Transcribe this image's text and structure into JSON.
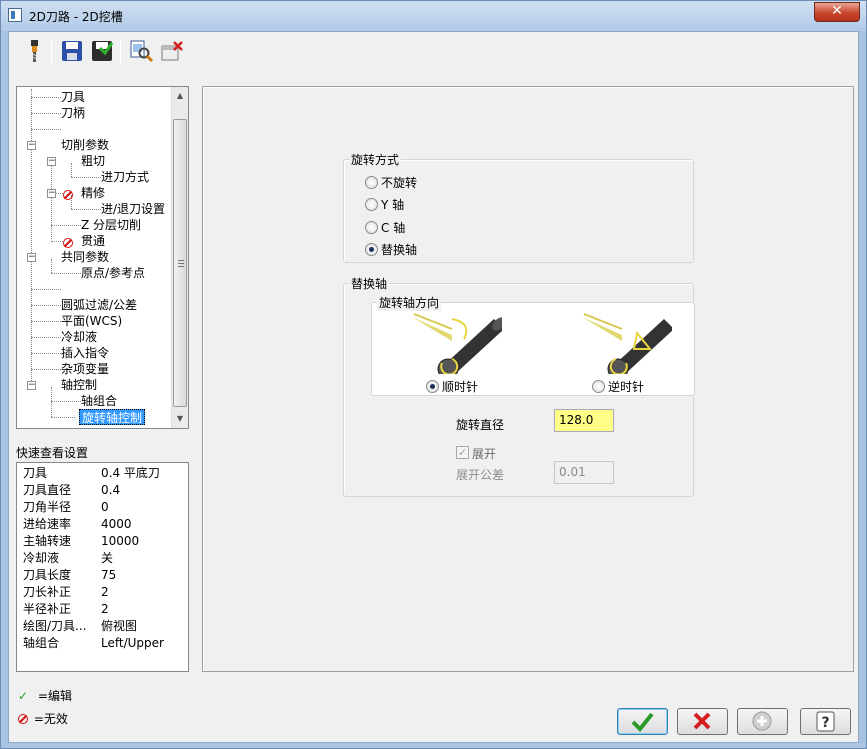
{
  "window": {
    "title": "2D刀路 - 2D挖槽",
    "close_glyph": "✕"
  },
  "toolbar": {
    "icons": [
      "tool-icon",
      "save-icon",
      "save-as-icon",
      "preview-icon",
      "clear-icon"
    ]
  },
  "tree": {
    "items": [
      {
        "label": "刀具"
      },
      {
        "label": "刀柄"
      },
      {
        "label": ""
      },
      {
        "label": "切削参数"
      },
      {
        "label": "粗切"
      },
      {
        "label": "进刀方式"
      },
      {
        "label": "精修"
      },
      {
        "label": "进/退刀设置"
      },
      {
        "label": "Z 分层切削"
      },
      {
        "label": "贯通"
      },
      {
        "label": "共同参数"
      },
      {
        "label": "原点/参考点"
      },
      {
        "label": ""
      },
      {
        "label": "圆弧过滤/公差"
      },
      {
        "label": "平面(WCS)"
      },
      {
        "label": "冷却液"
      },
      {
        "label": "插入指令"
      },
      {
        "label": "杂项变量"
      },
      {
        "label": "轴控制"
      },
      {
        "label": "轴组合"
      },
      {
        "label": "旋转轴控制"
      }
    ],
    "expander_glyph": "−",
    "selected": "旋转轴控制"
  },
  "quick_view": {
    "label": "快速查看设置",
    "rows": [
      {
        "key": "刀具",
        "value": "0.4 平底刀"
      },
      {
        "key": "刀具直径",
        "value": "0.4"
      },
      {
        "key": "刀角半径",
        "value": "0"
      },
      {
        "key": "进给速率",
        "value": "4000"
      },
      {
        "key": "主轴转速",
        "value": "10000"
      },
      {
        "key": "冷却液",
        "value": "关"
      },
      {
        "key": "刀具长度",
        "value": "75"
      },
      {
        "key": "刀长补正",
        "value": "2"
      },
      {
        "key": "半径补正",
        "value": "2"
      },
      {
        "key": "绘图/刀具...",
        "value": "俯视图"
      },
      {
        "key": "轴组合",
        "value": "Left/Upper"
      }
    ]
  },
  "legend": {
    "edit_mark": "✓",
    "edit": "=编辑",
    "invalid": "=无效"
  },
  "rotation": {
    "group_title": "旋转方式",
    "options": [
      {
        "label": "不旋转",
        "selected": false
      },
      {
        "label": "Y 轴",
        "selected": false
      },
      {
        "label": "C 轴",
        "selected": false
      },
      {
        "label": "替换轴",
        "selected": true
      }
    ]
  },
  "replace_axis": {
    "group_title": "替换轴",
    "direction_title": "旋转轴方向",
    "clockwise": "顺时针",
    "counterclockwise": "逆时针",
    "selected_direction": "顺时针",
    "diameter_label": "旋转直径",
    "diameter_value": "128.0",
    "unroll_label": "展开",
    "unroll_checked": true,
    "unroll_check_glyph": "✓",
    "unroll_tol_label": "展开公差",
    "unroll_tol_value": "0.01"
  },
  "buttons": {
    "ok": "ok-icon",
    "cancel": "cancel-icon",
    "add": "add-icon",
    "help": "help-icon",
    "help_glyph": "?"
  }
}
